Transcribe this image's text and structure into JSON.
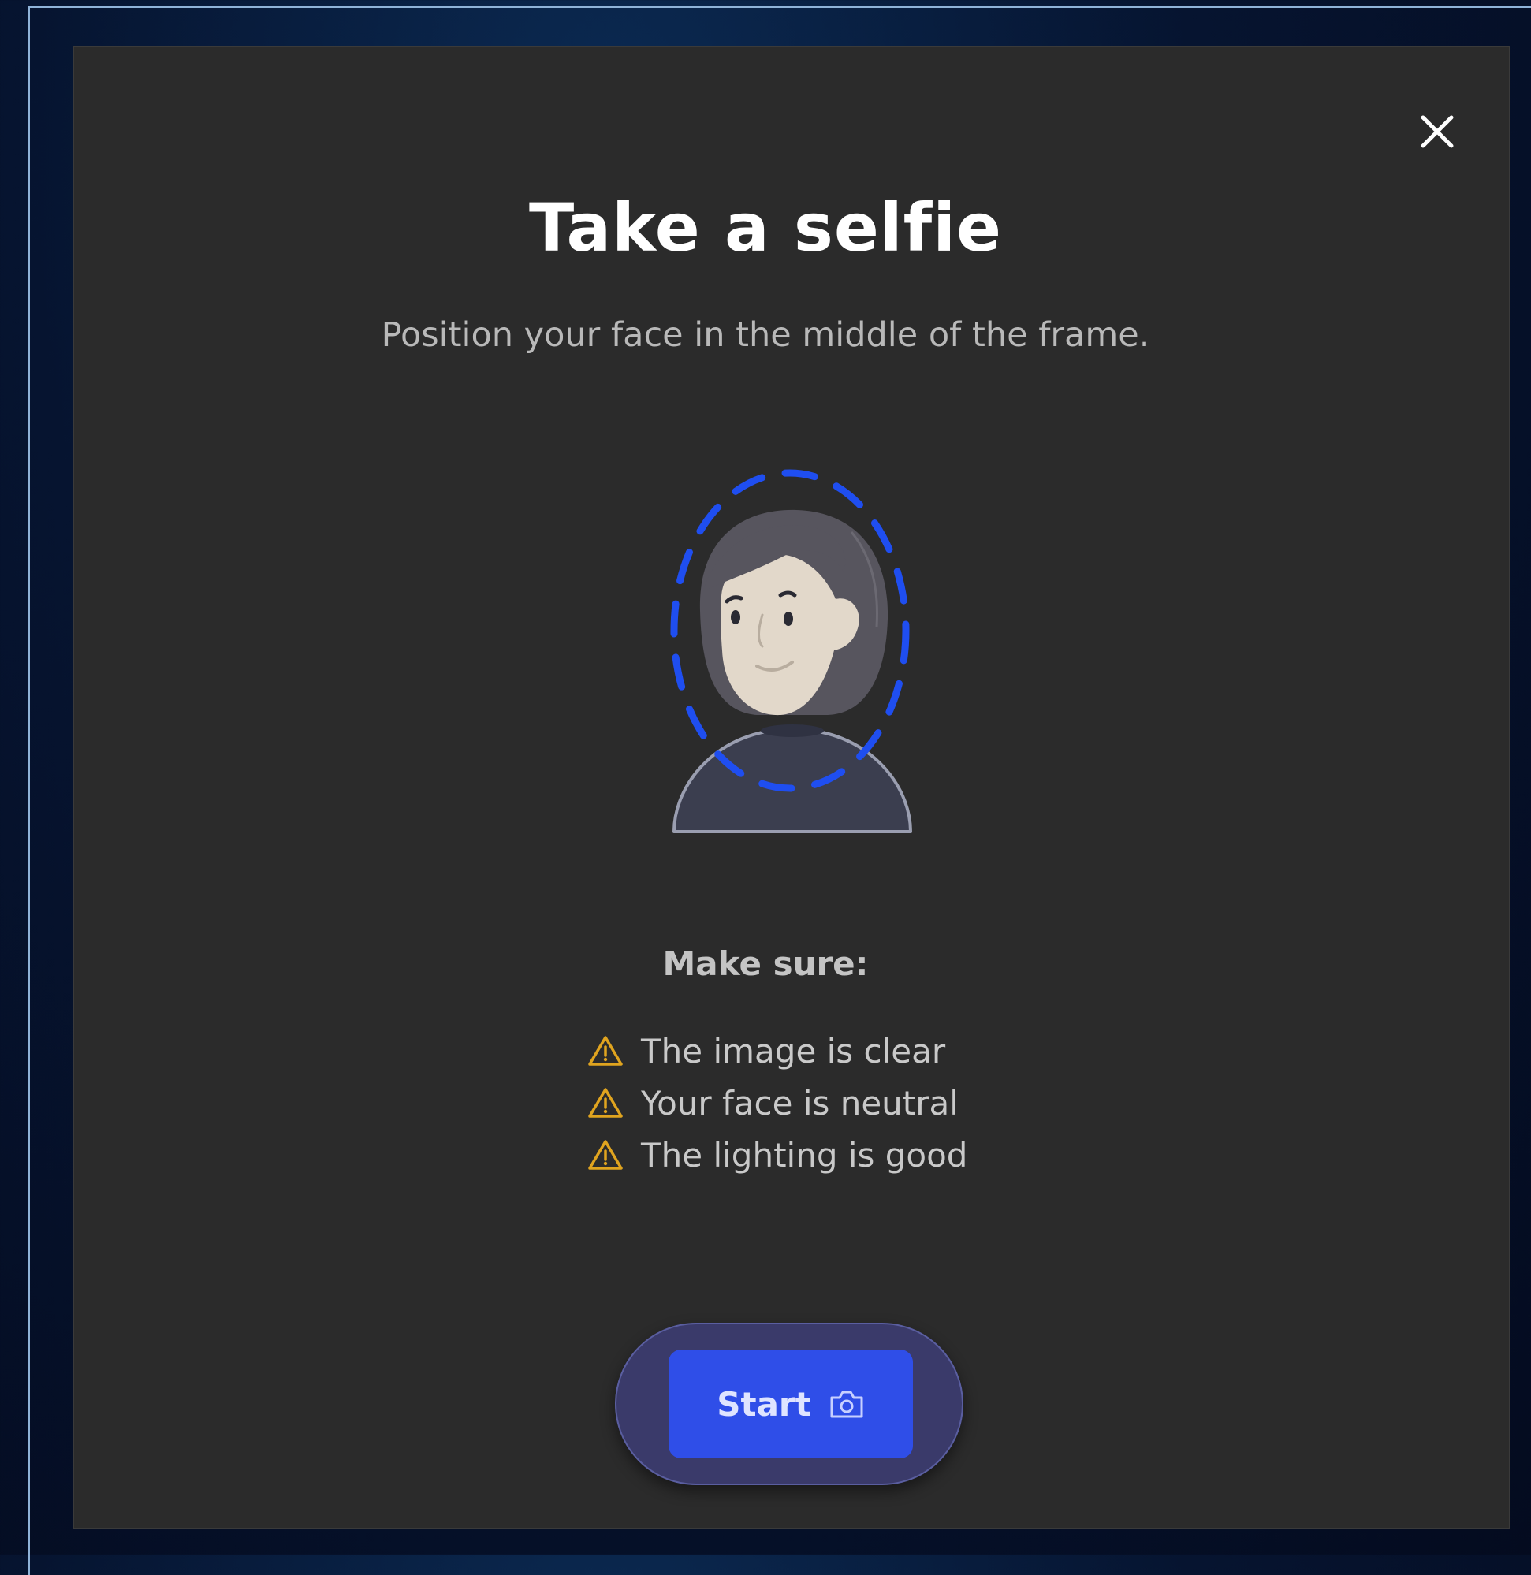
{
  "dialog": {
    "title": "Take a selfie",
    "subtitle": "Position your face in the middle of the frame.",
    "close_icon": "close-icon"
  },
  "illustration": {
    "icon": "selfie-face-frame-illustration",
    "frame_color": "#1f4ef0",
    "hair_color": "#57555e",
    "skin_color": "#e2d8ca",
    "body_color": "#3b3e4f"
  },
  "checklist": {
    "heading": "Make sure:",
    "icon": "warning-icon",
    "icon_color": "#e0a41f",
    "items": [
      {
        "label": "The image is clear"
      },
      {
        "label": "Your face is neutral"
      },
      {
        "label": "The lighting is good"
      }
    ]
  },
  "start": {
    "label": "Start",
    "icon": "camera-icon",
    "button_color": "#2f4ee8"
  }
}
